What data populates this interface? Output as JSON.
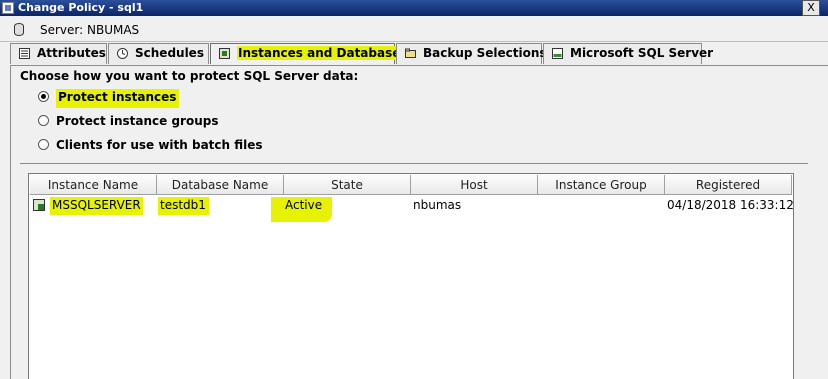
{
  "window": {
    "title": "Change Policy - sql1",
    "close_label": "X"
  },
  "server": {
    "label": "Server: NBUMAS"
  },
  "tabs": [
    {
      "label": "Attributes",
      "icon": "list-icon"
    },
    {
      "label": "Schedules",
      "icon": "clock-icon"
    },
    {
      "label": "Instances and Databases",
      "icon": "database-instance-icon",
      "active": true
    },
    {
      "label": "Backup Selections",
      "icon": "folder-icon"
    },
    {
      "label": "Microsoft SQL Server",
      "icon": "sql-icon"
    }
  ],
  "prompt": "Choose how you want to protect SQL Server data:",
  "options": [
    {
      "label": "Protect instances",
      "selected": true
    },
    {
      "label": "Protect instance groups",
      "selected": false
    },
    {
      "label": "Clients for use with batch files",
      "selected": false
    }
  ],
  "grid": {
    "columns": [
      "Instance Name",
      "Database Name",
      "State",
      "Host",
      "Instance Group",
      "Registered"
    ],
    "rows": [
      {
        "instance": "MSSQLSERVER",
        "database": "testdb1",
        "state": "Active",
        "host": "nbumas",
        "group": "",
        "registered": "04/18/2018 16:33:12"
      }
    ]
  },
  "highlight_color": "#e6f200"
}
